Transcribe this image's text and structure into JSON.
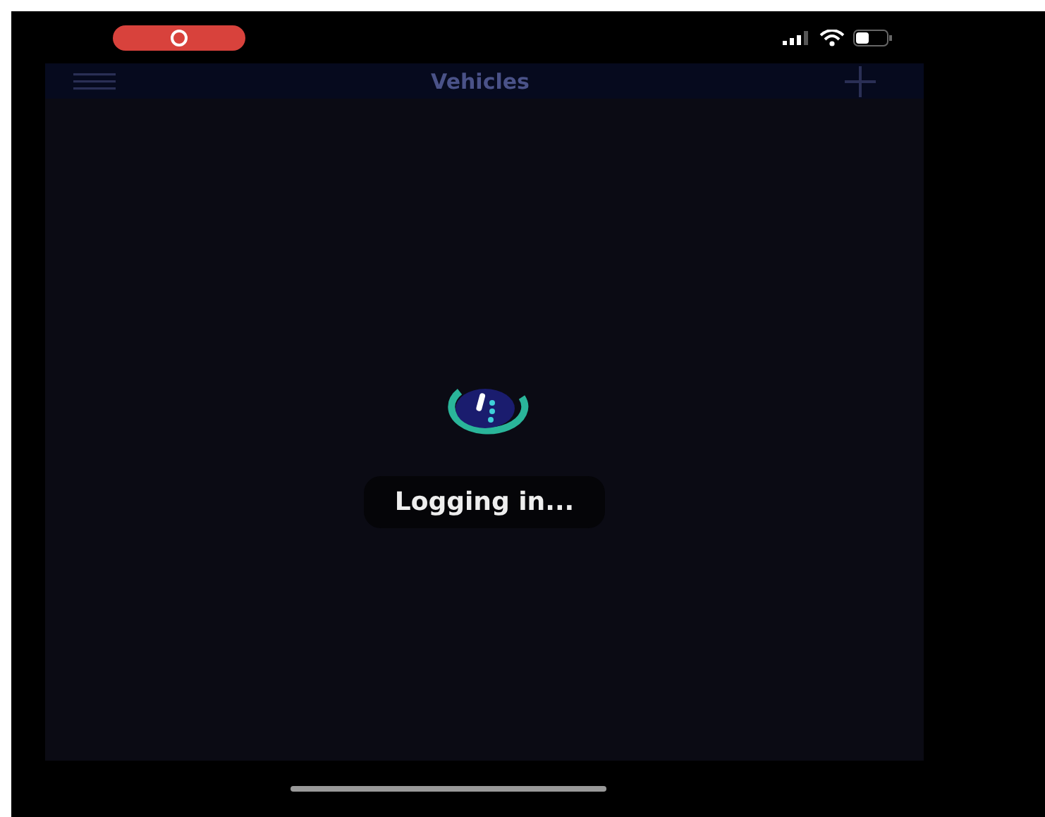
{
  "header": {
    "title": "Vehicles"
  },
  "loading": {
    "message": "Logging in..."
  }
}
